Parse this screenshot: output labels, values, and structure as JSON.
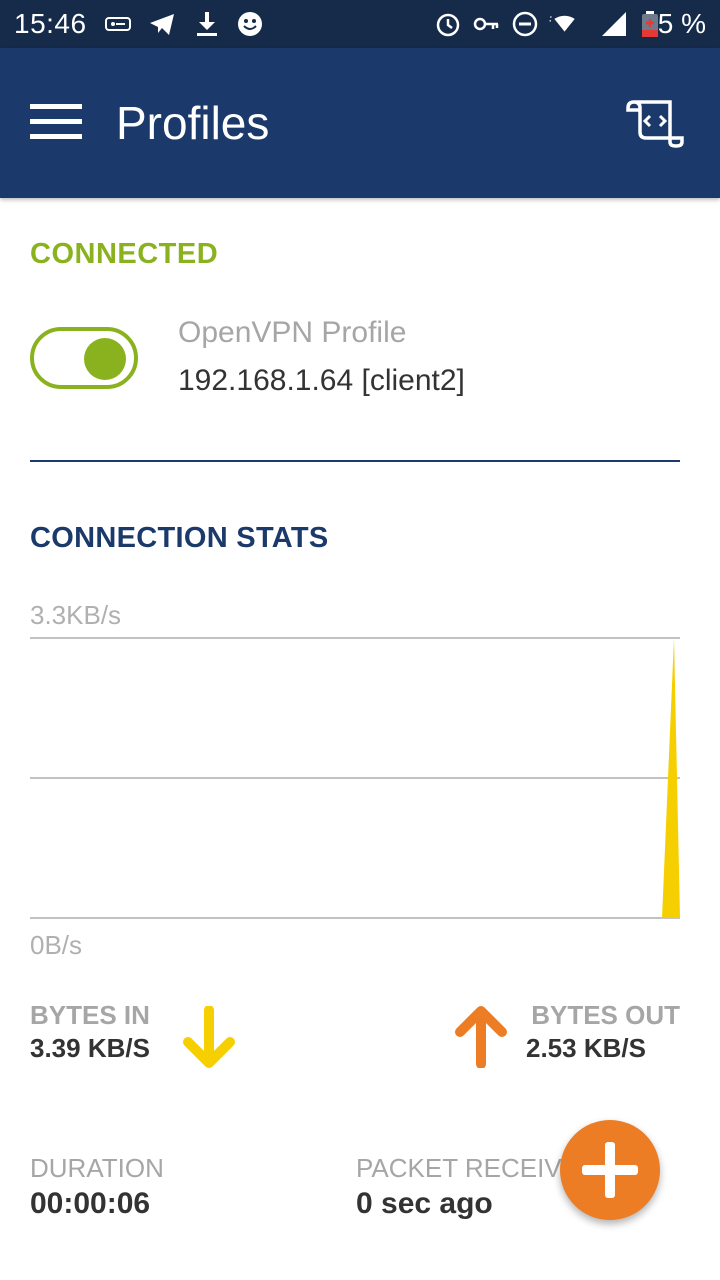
{
  "status_bar": {
    "time": "15:46",
    "battery_text": "5 %",
    "left_icons": [
      "vpn-key-box-icon",
      "telegram-icon",
      "download-icon",
      "face-icon"
    ],
    "right_icons": [
      "alarm-icon",
      "key-icon",
      "do-not-disturb-icon",
      "wifi-icon",
      "signal-icon",
      "battery-low-icon"
    ]
  },
  "app_bar": {
    "title": "Profiles",
    "menu_icon": "hamburger-menu-icon",
    "action_icon": "import-profile-icon"
  },
  "connection": {
    "section_title": "CONNECTED",
    "toggle_on": true,
    "profile_name": "OpenVPN Profile",
    "server": "192.168.1.64 [client2]"
  },
  "stats": {
    "section_title": "CONNECTION STATS",
    "chart_max_label": "3.3KB/s",
    "chart_min_label": "0B/s",
    "bytes_in_label": "BYTES IN",
    "bytes_in_value": "3.39 KB/S",
    "bytes_out_label": "BYTES OUT",
    "bytes_out_value": "2.53 KB/S",
    "duration_label": "DURATION",
    "duration_value": "00:00:06",
    "packet_label": "PACKET RECEIVED",
    "packet_value": "0 sec ago"
  },
  "chart_data": {
    "type": "area",
    "ylim": [
      0,
      3.3
    ],
    "y_unit": "KB/s",
    "series": [
      {
        "values": [
          0,
          0,
          0,
          0,
          0,
          0,
          0,
          0,
          0,
          0,
          0,
          0,
          0,
          0,
          0,
          0,
          0,
          0,
          0,
          3.3
        ]
      }
    ],
    "grid": true
  },
  "colors": {
    "status_bar": "#152b49",
    "app_bar": "#1b3a6b",
    "connected_green": "#8ab21f",
    "bytes_in_yellow": "#f5cf00",
    "bytes_out_orange": "#ec7d24",
    "fab_orange": "#ec7d24"
  },
  "fab_icon": "plus-icon"
}
